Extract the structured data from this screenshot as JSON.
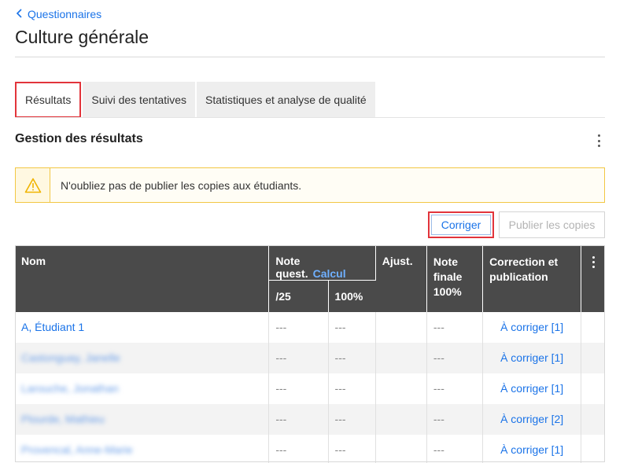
{
  "breadcrumb": {
    "back_label": "Questionnaires",
    "back_icon": "chevron-left-icon"
  },
  "page": {
    "title": "Culture générale"
  },
  "tabs": [
    {
      "label": "Résultats",
      "active": true
    },
    {
      "label": "Suivi des tentatives",
      "active": false
    },
    {
      "label": "Statistiques et analyse de qualité",
      "active": false
    }
  ],
  "section": {
    "title": "Gestion des résultats",
    "menu_icon": "more-vertical-icon"
  },
  "alert": {
    "icon": "warning-icon",
    "message": "N'oubliez pas de publier les copies aux étudiants.",
    "border_color": "#f2c744"
  },
  "actions": {
    "correct_label": "Corriger",
    "publish_label": "Publier les copies"
  },
  "table": {
    "headers": {
      "name": "Nom",
      "note_quest": "Note quest.",
      "calc": "Calcul",
      "note_sub_raw": "/25",
      "note_sub_pct": "100%",
      "adjust": "Ajust.",
      "final_line1": "Note",
      "final_line2": "finale",
      "final_line3": "100%",
      "correction_line1": "Correction et",
      "correction_line2": "publication"
    },
    "rows": [
      {
        "name": "A, Étudiant 1",
        "blurred": false,
        "raw": "---",
        "pct": "---",
        "adjust": "",
        "final": "---",
        "status": "À corriger [1]"
      },
      {
        "name": "Castonguay, Janelle",
        "blurred": true,
        "raw": "---",
        "pct": "---",
        "adjust": "",
        "final": "---",
        "status": "À corriger [1]"
      },
      {
        "name": "Larouche, Jonathan",
        "blurred": true,
        "raw": "---",
        "pct": "---",
        "adjust": "",
        "final": "---",
        "status": "À corriger [1]"
      },
      {
        "name": "Plourde, Mathieu",
        "blurred": true,
        "raw": "---",
        "pct": "---",
        "adjust": "",
        "final": "---",
        "status": "À corriger [2]"
      },
      {
        "name": "Provencal, Anne-Marie",
        "blurred": true,
        "raw": "---",
        "pct": "---",
        "adjust": "",
        "final": "---",
        "status": "À corriger [1]"
      }
    ]
  },
  "colors": {
    "accent": "#1a73e8",
    "highlight": "#e2343b",
    "header_bg": "#4a4a4a"
  }
}
